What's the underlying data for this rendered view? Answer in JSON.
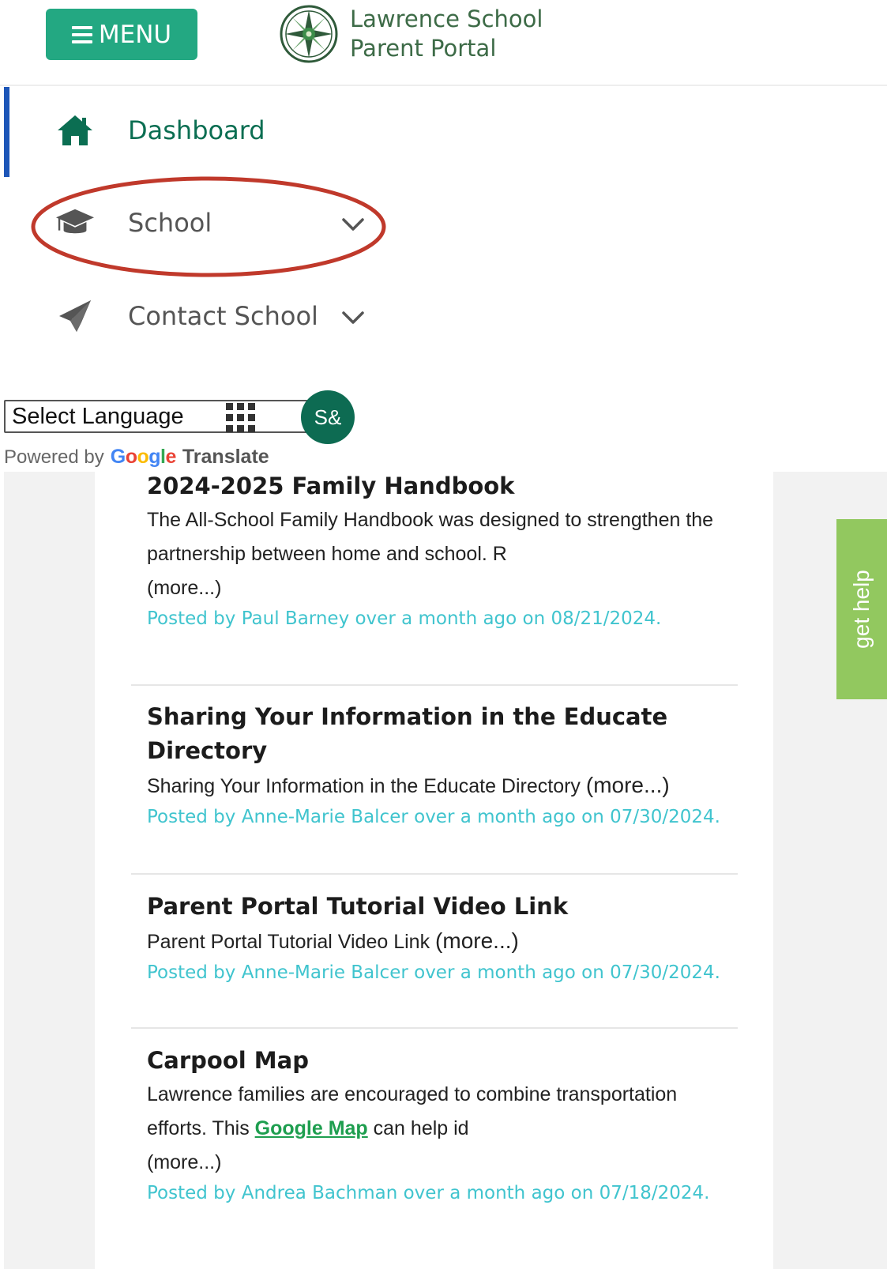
{
  "header": {
    "menu_label": "MENU",
    "brand_line1": "Lawrence School",
    "brand_line2": "Parent Portal"
  },
  "nav": {
    "items": [
      {
        "label": "Dashboard",
        "icon": "home-icon",
        "active": true
      },
      {
        "label": "School",
        "icon": "graduation-cap-icon",
        "expandable": true
      },
      {
        "label": "Contact School",
        "icon": "paper-plane-icon",
        "expandable": true
      }
    ]
  },
  "language": {
    "select_label": "Select Language",
    "badge": "S&",
    "powered_by": "Powered by",
    "google_letters": [
      "G",
      "o",
      "o",
      "g",
      "l",
      "e"
    ],
    "translate": "Translate"
  },
  "help_tab": "get help",
  "posts": [
    {
      "title": "2024-2025 Family Handbook",
      "excerpt": "The All-School Family Handbook was designed to strengthen the partnership between home and school. R",
      "more": "(more...)",
      "meta": "Posted by Paul Barney over a month ago on 08/21/2024."
    },
    {
      "title": "Sharing Your Information in the Educate Directory",
      "excerpt": "Sharing Your Information in the Educate Directory",
      "more": "(more...)",
      "meta": "Posted by Anne-Marie Balcer over a month ago on 07/30/2024."
    },
    {
      "title": "Parent Portal Tutorial Video Link",
      "excerpt": "Parent Portal Tutorial Video Link",
      "more": "(more...)",
      "meta": "Posted by Anne-Marie Balcer over a month ago on 07/30/2024."
    },
    {
      "title": "Carpool Map",
      "excerpt_before": "Lawrence families are encouraged to combine transportation efforts. This",
      "link": "Google Map",
      "excerpt_after": "can help id",
      "more": "(more...)",
      "meta": "Posted by Andrea Bachman over a month ago on 07/18/2024."
    }
  ],
  "colors": {
    "brand_green": "#23a882",
    "nav_active": "#0b6e52",
    "active_bar": "#1d56b8",
    "meta_teal": "#40c4ce",
    "help_green": "#92c85f",
    "highlight_red": "#c0392b"
  }
}
